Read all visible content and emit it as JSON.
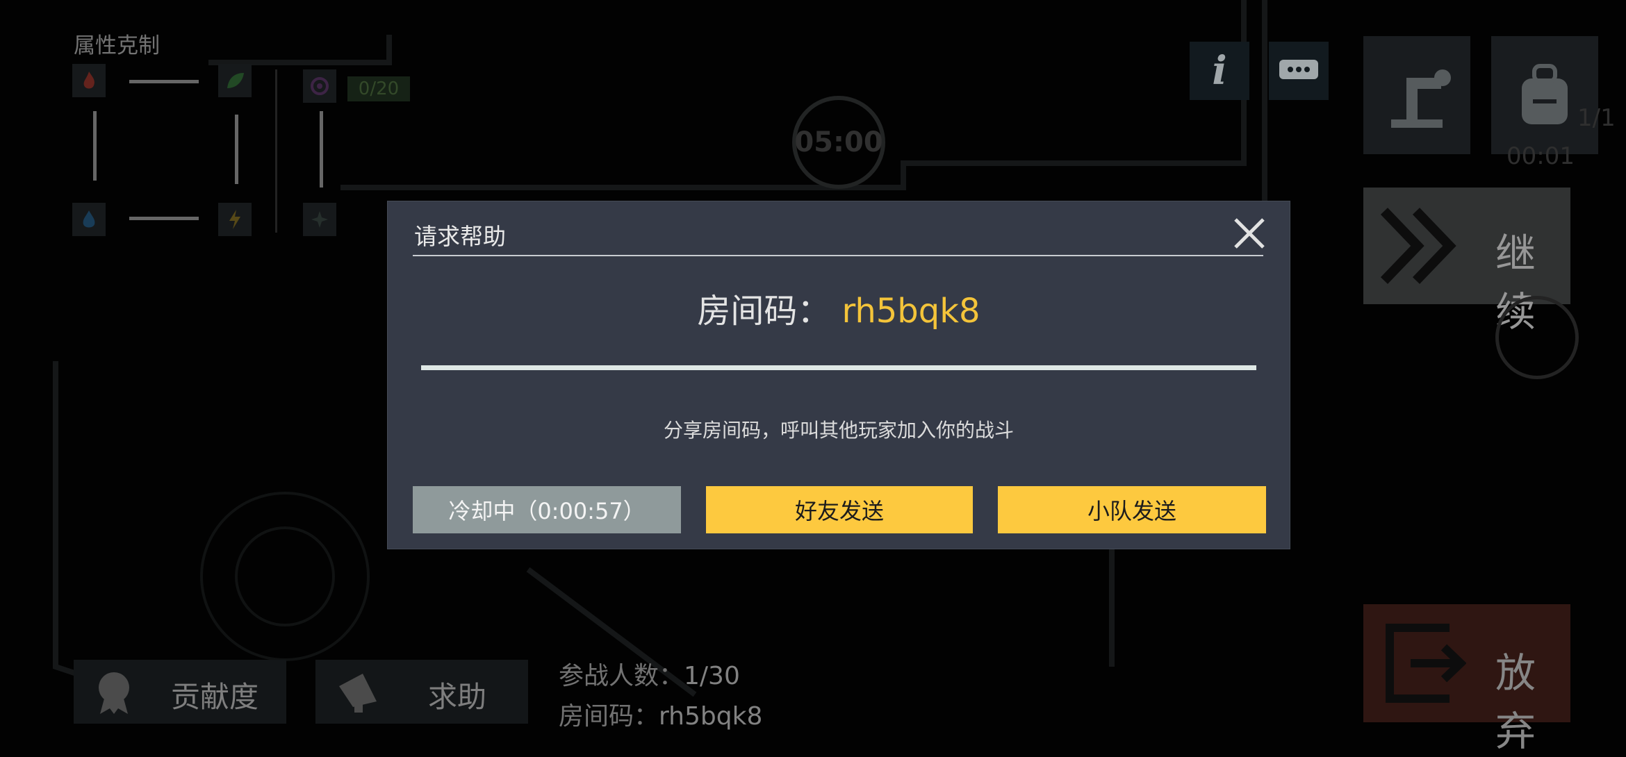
{
  "background": {
    "attribute_panel": {
      "title": "属性克制",
      "elements": [
        "fire-icon",
        "leaf-icon",
        "water-icon",
        "lightning-icon",
        "spiral-icon",
        "star-icon"
      ],
      "badge": "0/20"
    },
    "timer": "05:00",
    "top_buttons": {
      "info_icon": "info-icon",
      "chat_icon": "chat-icon",
      "build_icon": "robot-arm-icon",
      "bag_icon": "backpack-icon",
      "bag_count": "1/1",
      "bag_time": "00:01"
    },
    "continue_label": "继续",
    "giveup_label": "放弃",
    "contribution_label": "贡献度",
    "help_label": "求助",
    "participants_label": "参战人数：",
    "participants_value": "1/30",
    "room_label": "房间码：",
    "room_value": "rh5bqk8"
  },
  "modal": {
    "title": "请求帮助",
    "room_label": "房间码：",
    "room_code": "rh5bqk8",
    "hint": "分享房间码，呼叫其他玩家加入你的战斗",
    "cooldown_button": "冷却中（0:00:57）",
    "friend_button": "好友发送",
    "team_button": "小队发送"
  },
  "colors": {
    "accent": "#FDC93F",
    "modal_bg": "#353A47",
    "room_code": "#F4C43A",
    "cooldown": "#8F9A9B"
  }
}
